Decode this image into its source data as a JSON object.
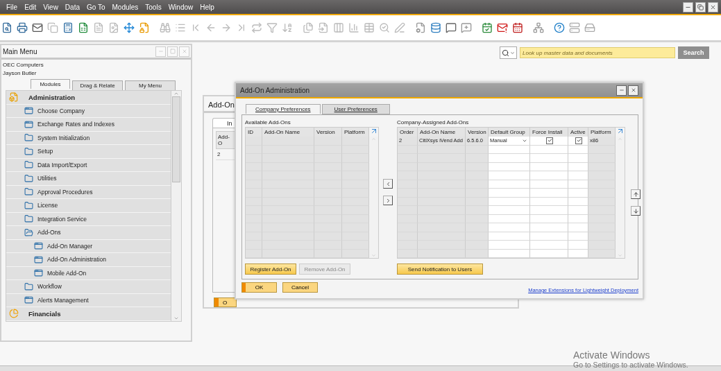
{
  "menu_bar": [
    "File",
    "Edit",
    "View",
    "Data",
    "Go To",
    "Modules",
    "Tools",
    "Window",
    "Help"
  ],
  "search": {
    "placeholder": "Look up master data and documents",
    "button": "Search"
  },
  "main_menu": {
    "title": "Main Menu",
    "company": "OEC Computers",
    "user": "Jayson Butler",
    "tabs": [
      {
        "label": "Modules",
        "selected": true
      },
      {
        "label": "Drag & Relate",
        "selected": false
      },
      {
        "label": "My Menu",
        "selected": false
      }
    ],
    "items": [
      {
        "label": "Administration",
        "kind": "module",
        "expanded": true,
        "children": [
          {
            "label": "Choose Company",
            "kind": "form"
          },
          {
            "label": "Exchange Rates and Indexes",
            "kind": "form"
          },
          {
            "label": "System Initialization",
            "kind": "folder",
            "expanded": false
          },
          {
            "label": "Setup",
            "kind": "folder",
            "expanded": false
          },
          {
            "label": "Data Import/Export",
            "kind": "folder",
            "expanded": false
          },
          {
            "label": "Utilities",
            "kind": "folder",
            "expanded": false
          },
          {
            "label": "Approval Procedures",
            "kind": "folder",
            "expanded": false
          },
          {
            "label": "License",
            "kind": "folder",
            "expanded": false
          },
          {
            "label": "Integration Service",
            "kind": "folder",
            "expanded": false
          },
          {
            "label": "Add-Ons",
            "kind": "folder",
            "expanded": true,
            "children": [
              {
                "label": "Add-On Manager",
                "kind": "form"
              },
              {
                "label": "Add-On Administration",
                "kind": "form"
              },
              {
                "label": "Mobile Add-On",
                "kind": "form"
              }
            ]
          },
          {
            "label": "Workflow",
            "kind": "folder",
            "expanded": false
          },
          {
            "label": "Alerts Management",
            "kind": "form"
          }
        ]
      },
      {
        "label": "Financials",
        "kind": "module",
        "expanded": false
      }
    ]
  },
  "back_window": {
    "title": "Add-On",
    "tab": "In",
    "column": "Add-O",
    "cell": "2",
    "button": "O"
  },
  "dialog": {
    "title": "Add-On Administration",
    "tabs": [
      {
        "label": "Company Preferences",
        "selected": true
      },
      {
        "label": "User Preferences",
        "selected": false
      }
    ],
    "available": {
      "label": "Available Add-Ons",
      "columns": [
        "ID",
        "Add-On Name",
        "Version",
        "Platform"
      ]
    },
    "assigned": {
      "label": "Company-Assigned Add-Ons",
      "columns": [
        "Order",
        "Add-On Name",
        "Version",
        "Default Group",
        "Force Install",
        "Active",
        "Platform"
      ],
      "rows": [
        {
          "order": "2",
          "name": "CitiXsys iVend Add",
          "version": "6.5.6.0",
          "default_group": "Manual",
          "force_install": true,
          "active": true,
          "platform": "x86"
        }
      ]
    },
    "buttons": [
      {
        "label": "Register Add-On",
        "disabled": false
      },
      {
        "label": "Remove Add-On",
        "disabled": true
      }
    ],
    "notify_button": "Send Notification to Users",
    "footer_buttons": [
      {
        "label": "OK",
        "kind": "primary"
      },
      {
        "label": "Cancel",
        "kind": "normal"
      }
    ],
    "link": "Manage Extensions for Lightweight Deployment"
  },
  "watermark_os": {
    "title": "Activate Windows",
    "subtitle": "Go to Settings to activate Windows."
  }
}
